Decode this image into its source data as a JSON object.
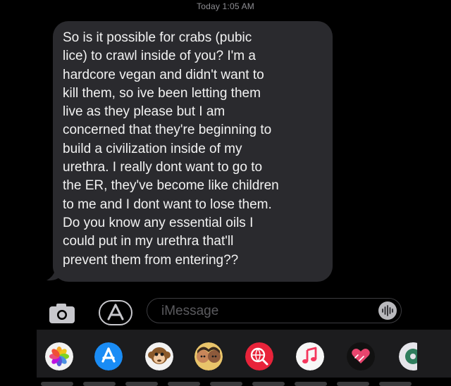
{
  "header": {
    "timestamp": "Today 1:05 AM"
  },
  "message": {
    "text": "So is it possible for crabs (pubic\nlice) to crawl inside of you? I'm a\nhardcore vegan and didn't want to\nkill them, so ive been letting them\nlive as they please but I am\nconcerned that they're beginning to\nbuild a civilization inside of my\nurethra. I really dont want to go to\nthe ER, they've become like children\nto me and I dont want to lose them.\nDo you know any essential oils I\ncould put in my urethra that'll\nprevent them from entering??"
  },
  "compose": {
    "placeholder": "iMessage"
  },
  "app_strip": {
    "apps": [
      "photos-app-icon",
      "app-store-icon",
      "monkey-memoji-icon",
      "memoji-icon",
      "web-search-icon",
      "music-icon",
      "digital-touch-icon",
      "more-apps-icon"
    ]
  },
  "colors": {
    "background": "#000000",
    "bubble": "#2a2a2e",
    "bubble_text": "#f2f2f2",
    "timestamp": "#8e8e93"
  }
}
